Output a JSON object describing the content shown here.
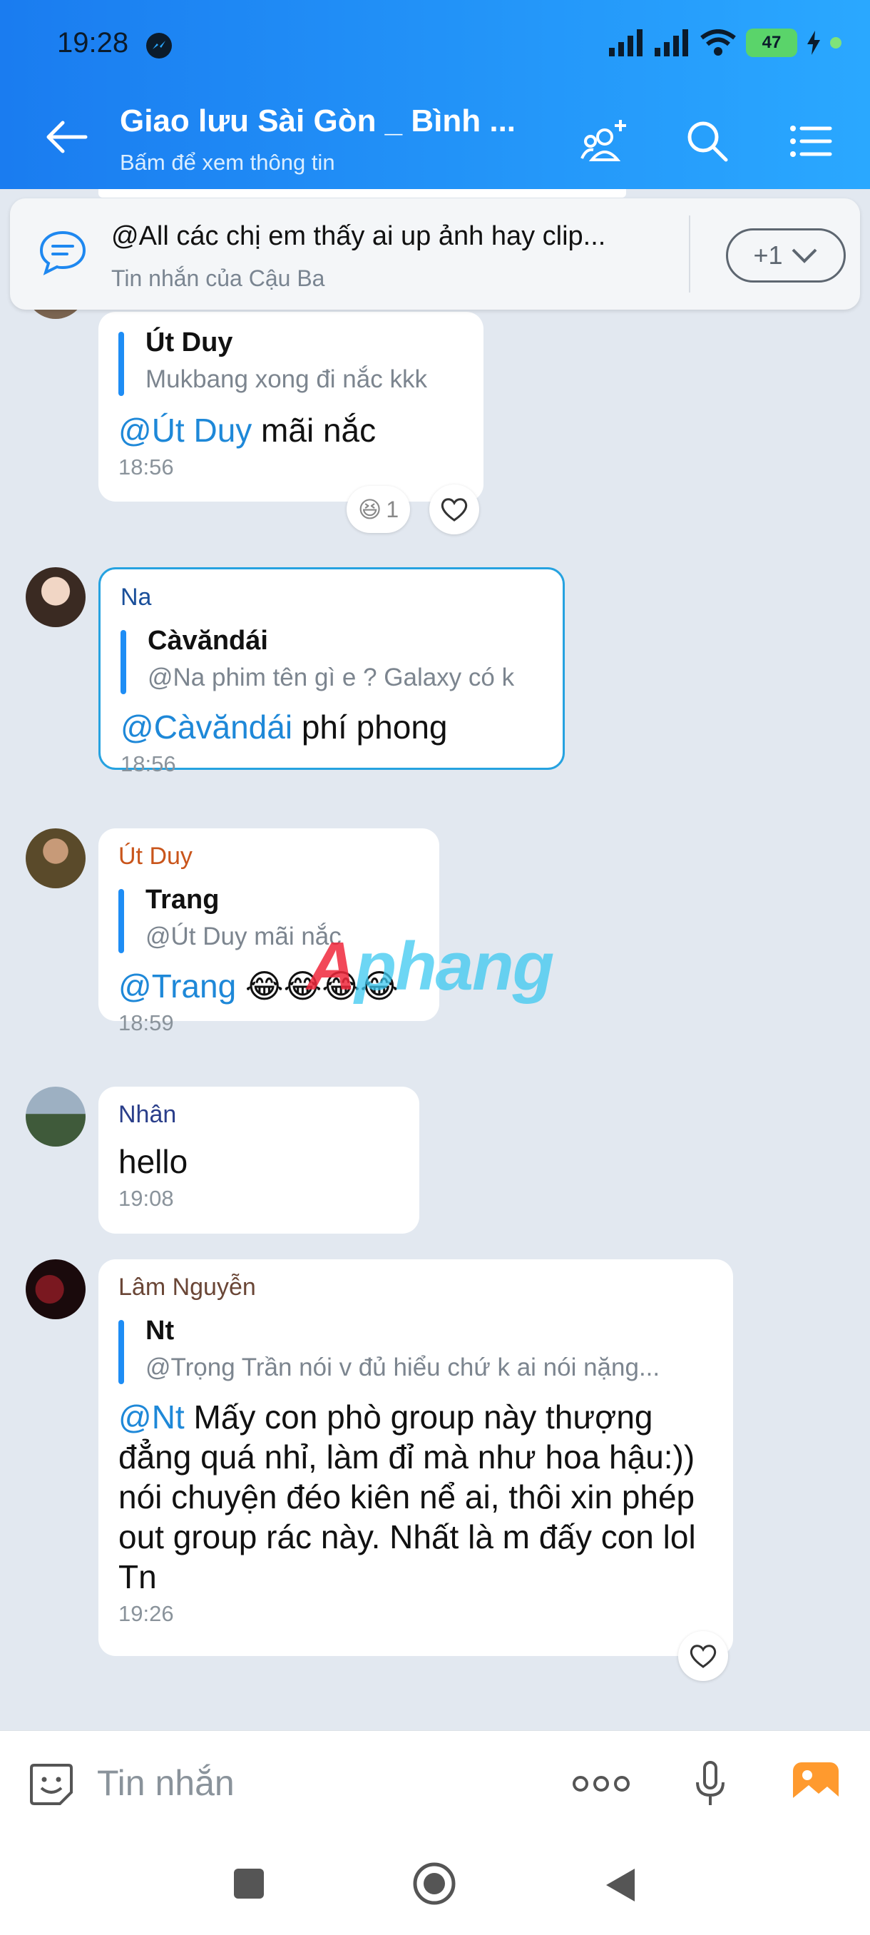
{
  "status": {
    "time": "19:28",
    "battery": "47"
  },
  "header": {
    "title": "Giao lưu Sài Gòn _ Bình ...",
    "subtitle": "Bấm để xem thông tin"
  },
  "pinned": {
    "text": "@All các chị em thấy ai up ảnh hay clip...",
    "sub": "Tin nhắn của Cậu Ba",
    "more": "+1"
  },
  "messages": [
    {
      "quote_name": "Út Duy",
      "quote_text": "Mukbang xong đi nắc kkk",
      "mention": "@Út Duy",
      "text": " mãi nắc",
      "time": "18:56",
      "reaction_count": "1"
    },
    {
      "sender": "Na",
      "quote_name": "Càvăndái",
      "quote_text": "@Na phim tên gì e ? Galaxy có k",
      "mention": "@Càvăndái",
      "text": " phí phong",
      "time": "18:56"
    },
    {
      "sender": "Út Duy",
      "quote_name": "Trang",
      "quote_text": "@Út Duy mãi nắc",
      "mention": "@Trang",
      "text": " 😂😂😂😂",
      "time": "18:59"
    },
    {
      "sender": "Nhân",
      "text": "hello",
      "time": "19:08"
    },
    {
      "sender": "Lâm Nguyễn",
      "quote_name": "Nt",
      "quote_text": "@Trọng Trần nói v đủ hiểu chứ k ai nói nặng...",
      "mention": "@Nt",
      "text": " Mấy con phò group này thượng đẳng quá nhỉ, làm đỉ mà như hoa hậu:)) nói chuyện đéo kiên nể ai, thôi xin phép out group rác này. Nhất là m đấy con lol Tn",
      "time": "19:26"
    }
  ],
  "watermark": {
    "first": "A",
    "rest": "phang"
  },
  "input": {
    "placeholder": "Tin nhắn"
  },
  "colors": {
    "header_start": "#1a7cf0",
    "header_end": "#2aa8ff",
    "mention": "#1e88d8",
    "highlight_border": "#26a2e0"
  }
}
